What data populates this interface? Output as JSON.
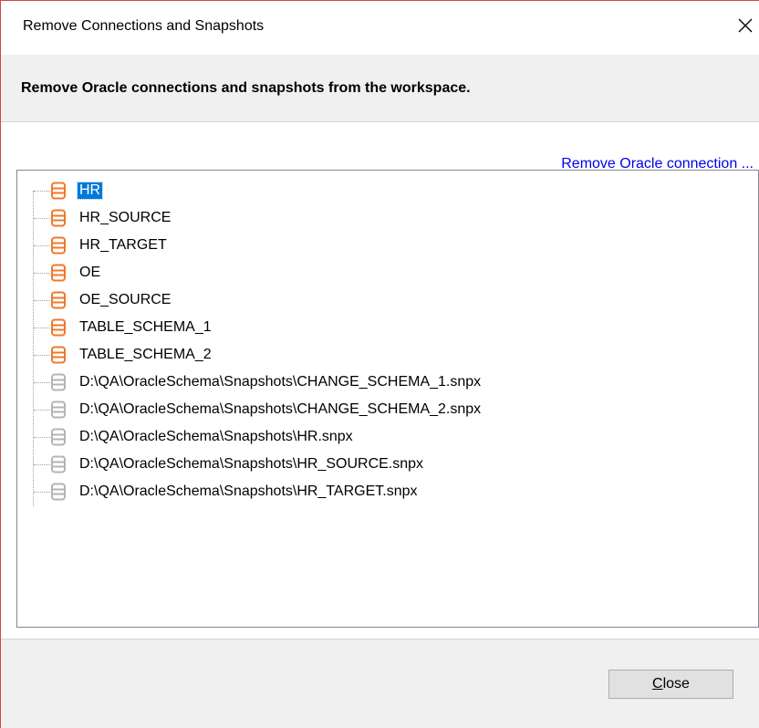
{
  "window": {
    "title": "Remove Connections and Snapshots",
    "close_glyph": "✕"
  },
  "header": {
    "text": "Remove Oracle connections and snapshots from the workspace."
  },
  "content": {
    "remove_link": "Remove Oracle connection ..."
  },
  "tree": {
    "items": [
      {
        "label": "HR",
        "kind": "connection",
        "selected": true
      },
      {
        "label": "HR_SOURCE",
        "kind": "connection"
      },
      {
        "label": "HR_TARGET",
        "kind": "connection"
      },
      {
        "label": "OE",
        "kind": "connection"
      },
      {
        "label": "OE_SOURCE",
        "kind": "connection"
      },
      {
        "label": "TABLE_SCHEMA_1",
        "kind": "connection"
      },
      {
        "label": "TABLE_SCHEMA_2",
        "kind": "connection"
      },
      {
        "label": "D:\\QA\\OracleSchema\\Snapshots\\CHANGE_SCHEMA_1.snpx",
        "kind": "snapshot"
      },
      {
        "label": "D:\\QA\\OracleSchema\\Snapshots\\CHANGE_SCHEMA_2.snpx",
        "kind": "snapshot"
      },
      {
        "label": "D:\\QA\\OracleSchema\\Snapshots\\HR.snpx",
        "kind": "snapshot"
      },
      {
        "label": "D:\\QA\\OracleSchema\\Snapshots\\HR_SOURCE.snpx",
        "kind": "snapshot"
      },
      {
        "label": "D:\\QA\\OracleSchema\\Snapshots\\HR_TARGET.snpx",
        "kind": "snapshot"
      }
    ]
  },
  "footer": {
    "close_label_first": "C",
    "close_label_rest": "lose"
  },
  "colors": {
    "connection_icon": "#f07828",
    "snapshot_icon": "#b4b4b4",
    "selection": "#0078d7",
    "link": "#0000ee",
    "window_border": "#d04848"
  },
  "icons": {
    "connection": "database-icon",
    "snapshot": "snapshot-database-icon",
    "close": "close-icon"
  }
}
